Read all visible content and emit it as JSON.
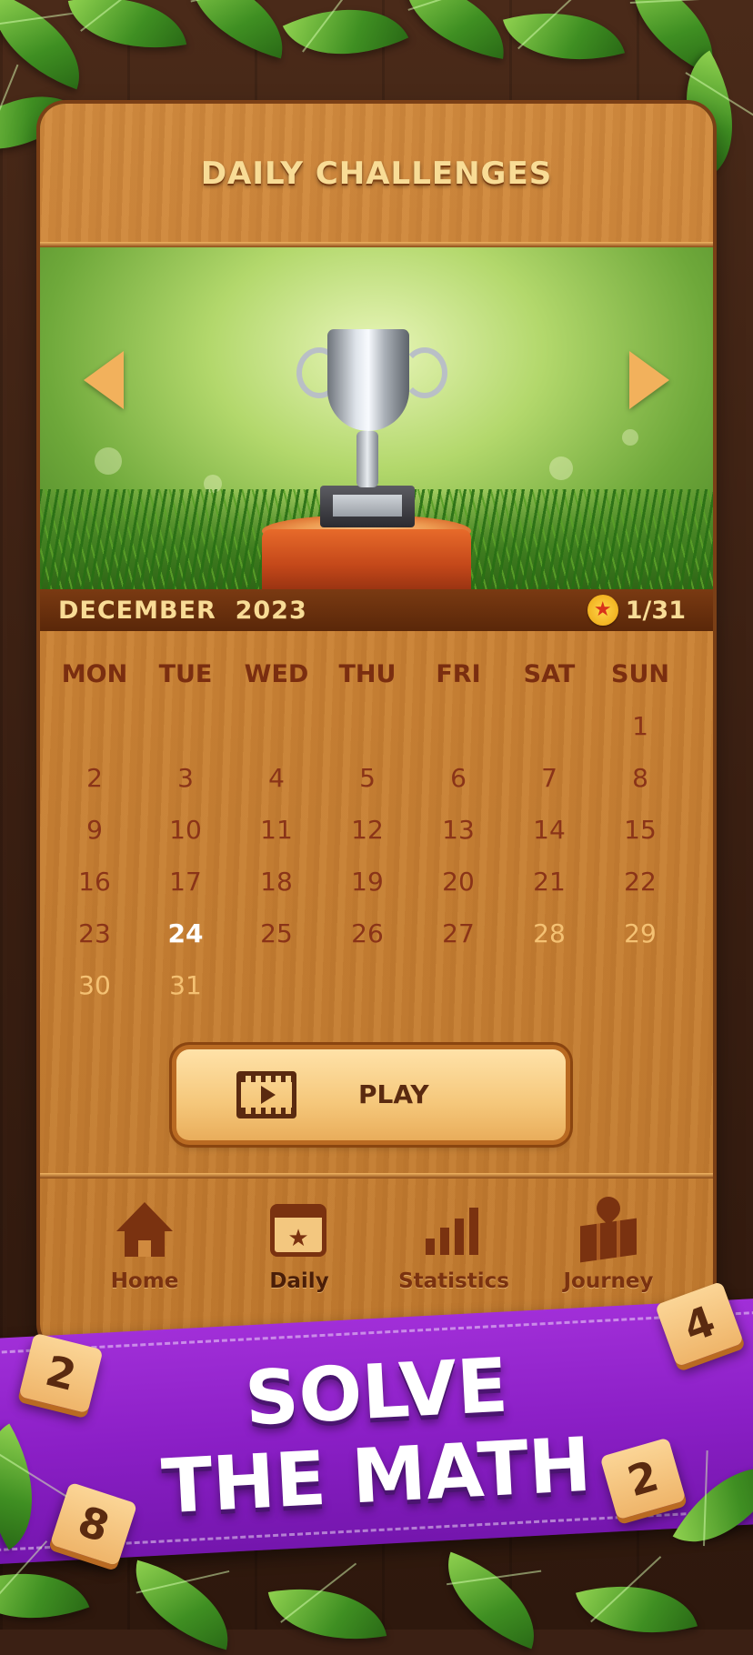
{
  "title": "DAILY CHALLENGES",
  "calendar": {
    "month_label": "DECEMBER  2023",
    "progress": "1/31",
    "weekdays": [
      "MON",
      "TUE",
      "WED",
      "THU",
      "FRI",
      "SAT",
      "SUN"
    ],
    "weeks": [
      [
        "",
        "",
        "",
        "",
        "",
        "",
        "1"
      ],
      [
        "2",
        "3",
        "4",
        "5",
        "6",
        "7",
        "8"
      ],
      [
        "9",
        "10",
        "11",
        "12",
        "13",
        "14",
        "15"
      ],
      [
        "16",
        "17",
        "18",
        "19",
        "20",
        "21",
        "22"
      ],
      [
        "23",
        "24",
        "25",
        "26",
        "27",
        "28",
        "29"
      ],
      [
        "30",
        "31",
        "",
        "",
        "",
        "",
        ""
      ]
    ],
    "today": "24",
    "future_days": [
      "28",
      "29",
      "30",
      "31"
    ]
  },
  "play_label": "PLAY",
  "nav": [
    {
      "label": "Home",
      "icon": "home-icon"
    },
    {
      "label": "Daily",
      "icon": "calendar-star-icon",
      "active": true
    },
    {
      "label": "Statistics",
      "icon": "bar-chart-icon"
    },
    {
      "label": "Journey",
      "icon": "map-pin-icon"
    }
  ],
  "banner": {
    "line1": "SOLVE",
    "line2": "THE MATH"
  },
  "tiles": [
    "2",
    "4",
    "8",
    "2"
  ],
  "colors": {
    "today": "#1d7a25",
    "banner": "#8b1fc6",
    "wood": "#c98236"
  }
}
